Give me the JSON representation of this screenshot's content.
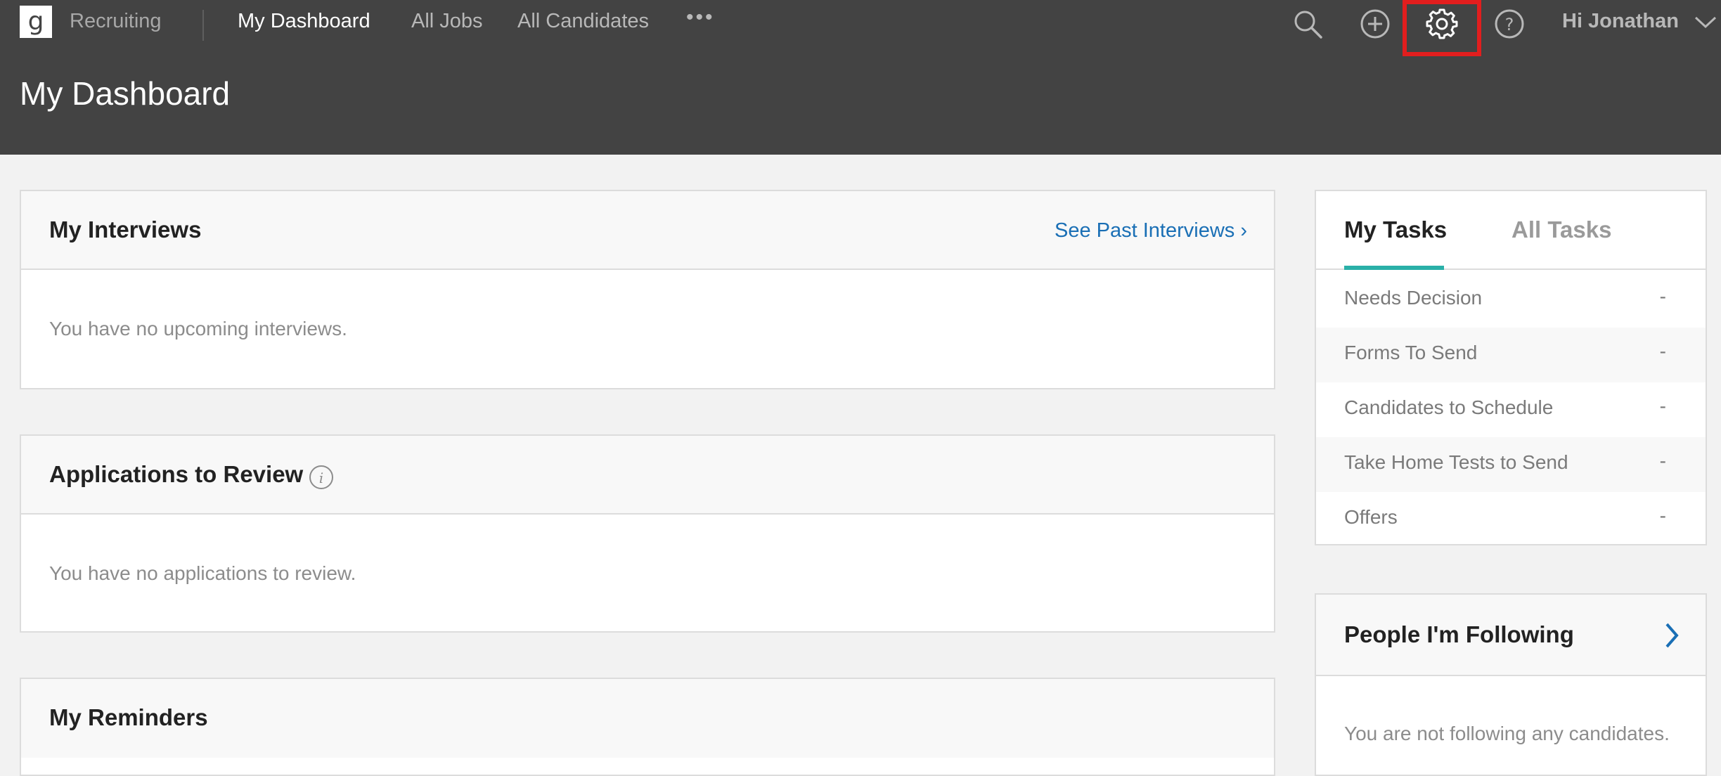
{
  "nav": {
    "app_name": "Recruiting",
    "items": [
      {
        "label": "My Dashboard",
        "active": true
      },
      {
        "label": "All Jobs",
        "active": false
      },
      {
        "label": "All Candidates",
        "active": false
      }
    ],
    "more_label": "•••",
    "greeting": "Hi Jonathan",
    "icons": [
      "search-icon",
      "add-circle-icon",
      "gear-icon",
      "help-icon",
      "chevron-down-icon"
    ]
  },
  "page": {
    "title": "My Dashboard"
  },
  "interviews": {
    "title": "My Interviews",
    "link": "See Past Interviews ›",
    "empty": "You have no upcoming interviews."
  },
  "applications": {
    "title": "Applications to Review",
    "empty": "You have no applications to review."
  },
  "reminders": {
    "title": "My Reminders"
  },
  "tasks": {
    "tabs": [
      "My Tasks",
      "All Tasks"
    ],
    "rows": [
      {
        "label": "Needs Decision",
        "count": "-"
      },
      {
        "label": "Forms To Send",
        "count": "-"
      },
      {
        "label": "Candidates to Schedule",
        "count": "-"
      },
      {
        "label": "Take Home Tests to Send",
        "count": "-"
      },
      {
        "label": "Offers",
        "count": "-"
      }
    ]
  },
  "following": {
    "title": "People I'm Following",
    "empty": "You are not following any candidates."
  },
  "colors": {
    "header_bg": "#434343",
    "page_bg": "#f2f2f2",
    "link": "#1a6fb5",
    "tab_accent": "#2ab0a8",
    "highlight": "#e21e1e"
  }
}
